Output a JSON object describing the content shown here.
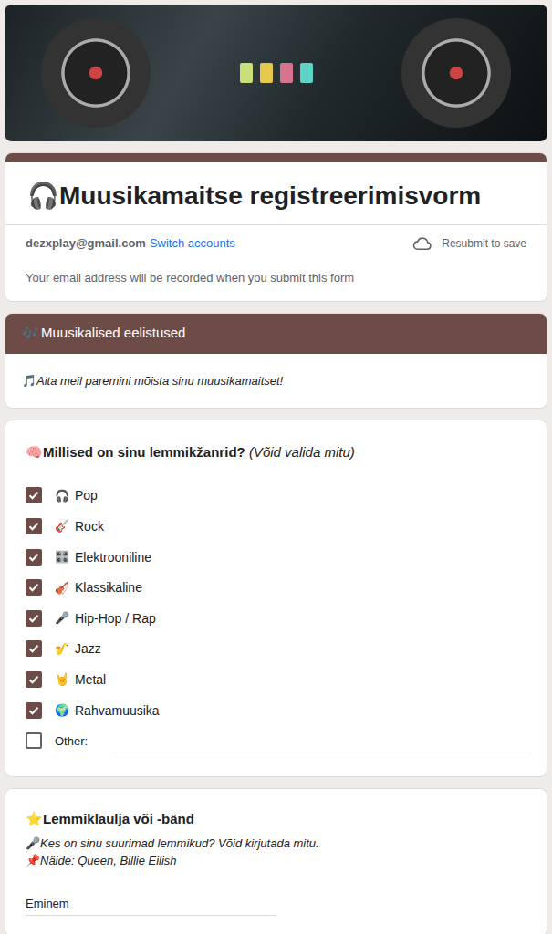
{
  "form": {
    "title_icon": "🎧",
    "title": "Muusikamaitse registreerimisvorm"
  },
  "account": {
    "email": "dezxplay@gmail.com",
    "switch_link": "Switch accounts",
    "save_status": "Resubmit to save",
    "notice": "Your email address will be recorded when you submit this form"
  },
  "section": {
    "icon": "🎶",
    "title": "Muusikalised eelistused",
    "description_icon": "🎵",
    "description": "Aita meil paremini mõista sinu muusikamaitset!"
  },
  "genre_question": {
    "icon": "🧠",
    "title": "Millised on sinu lemmikžanrid?",
    "hint": "(Võid valida mitu)",
    "options": [
      {
        "icon": "🎧",
        "label": "Pop",
        "checked": true
      },
      {
        "icon": "🎸",
        "label": "Rock",
        "checked": true
      },
      {
        "icon": "🎛️",
        "label": "Elektrooniline",
        "checked": true
      },
      {
        "icon": "🎻",
        "label": "Klassikaline",
        "checked": true
      },
      {
        "icon": "🎤",
        "label": "Hip-Hop / Rap",
        "checked": true
      },
      {
        "icon": "🎷",
        "label": "Jazz",
        "checked": true
      },
      {
        "icon": "🤘",
        "label": "Metal",
        "checked": true
      },
      {
        "icon": "🌍",
        "label": "Rahvamuusika",
        "checked": true
      }
    ],
    "other": {
      "label": "Other:",
      "checked": false,
      "value": ""
    }
  },
  "artist_question": {
    "icon": "⭐",
    "title": "Lemmiklaulja või -bänd",
    "description": [
      {
        "icon": "🎤",
        "text": "Kes on sinu suurimad lemmikud? Võid kirjutada mitu."
      },
      {
        "icon": "📌",
        "text": "Näide: Queen, Billie Eilish"
      }
    ],
    "answer": "Eminem"
  }
}
